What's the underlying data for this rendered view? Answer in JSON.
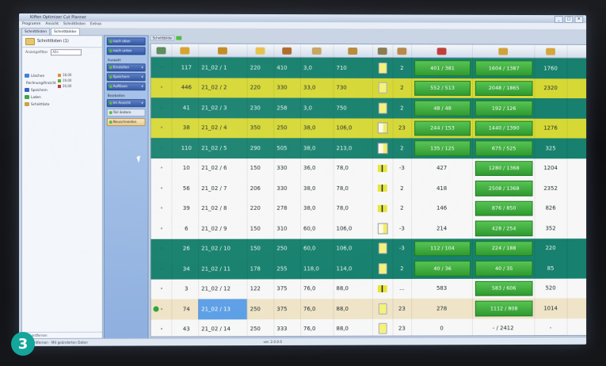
{
  "window": {
    "title": "Kiffen Optimizer Cut Planner",
    "controls": [
      "_",
      "□",
      "✕"
    ]
  },
  "menu": [
    "Programm",
    "Ansicht",
    "Schnittlisten",
    "Extras"
  ],
  "tabs": [
    "Schnittlisten",
    "Schnittbilder"
  ],
  "left_panel": {
    "title": "Schnittlisten (1)",
    "filter_label": "Anzeigefilter",
    "filter_value": "Alle",
    "items": [
      {
        "label": "Löschen",
        "color": "#3b7fd6"
      },
      {
        "label": "Rechnung/Ansicht",
        "color": "#9bb3d6"
      },
      {
        "label": "Speichern",
        "color": "#2a60c0"
      },
      {
        "label": "Laden",
        "color": "#3aa43a"
      },
      {
        "label": "Schnittliste",
        "color": "#c9a23a"
      }
    ],
    "legend": [
      {
        "label": "18,00",
        "color": "#e08a2a"
      },
      {
        "label": "19,00",
        "color": "#55aa33"
      },
      {
        "label": "20,00",
        "color": "#c03030"
      }
    ],
    "status": "Wolf entfernen"
  },
  "actions": {
    "buttons": [
      {
        "label": "nach oben",
        "style": "blue"
      },
      {
        "label": "nach unten",
        "style": "blue"
      },
      {
        "label": "Auswahl",
        "style": "sep"
      },
      {
        "label": "Einstellen",
        "style": "blue",
        "arrow": true
      },
      {
        "label": "Speichern",
        "style": "blue",
        "arrow": true
      },
      {
        "label": "Auflösen",
        "style": "blue",
        "arrow": true
      },
      {
        "label": "Bearbeiten",
        "style": "sep"
      },
      {
        "label": "Im Ansicht",
        "style": "blue",
        "arrow": true
      },
      {
        "label": "Teil ändern",
        "style": "light"
      },
      {
        "label": "Neuschneiden",
        "style": "orange"
      }
    ]
  },
  "toolstrip": {
    "label": "Schnittbilder"
  },
  "grid": {
    "header_icons": [
      {
        "name": "status-icon",
        "color": "#5a8a5a"
      },
      {
        "name": "parts-icon",
        "color": "#d7a22a"
      },
      {
        "name": "board-id-icon",
        "color": "#c28a20"
      },
      {
        "name": "length-icon",
        "color": "#e6c24a"
      },
      {
        "name": "width-icon",
        "color": "#b06a2a"
      },
      {
        "name": "thickness-icon",
        "color": "#c8a560"
      },
      {
        "name": "area-icon",
        "color": "#b88a3a"
      },
      {
        "name": "pattern-icon",
        "color": "#8a7a50"
      },
      {
        "name": "count-icon",
        "color": "#b8884a"
      },
      {
        "name": "sum-parts-icon",
        "color": "#c0403a"
      },
      {
        "name": "sum-area-icon",
        "color": "#d0a23a"
      },
      {
        "name": "stack-icon",
        "color": "#d6a63a"
      }
    ],
    "rows": [
      {
        "color": "teal",
        "n": "117",
        "id": "21_02 / 1",
        "l": "220",
        "w": "410",
        "t": "3,0",
        "a": "710",
        "g": "yellow",
        "c": "2",
        "p": "401 / 381",
        "s": "1604 / 1387",
        "x": "1760",
        "p_box": true,
        "s_box": true
      },
      {
        "color": "yellow",
        "n": "446",
        "id": "21_02 / 2",
        "l": "220",
        "w": "330",
        "t": "33,0",
        "a": "730",
        "g": "yellow",
        "c": "2",
        "p": "552 / 513",
        "s": "2048 / 1865",
        "x": "2320",
        "p_box": true,
        "s_box": true
      },
      {
        "color": "teal",
        "n": "41",
        "id": "21_02 / 3",
        "l": "230",
        "w": "258",
        "t": "3,0",
        "a": "750",
        "g": "yellow",
        "c": "2",
        "p": "48 / 48",
        "s": "192 / 126",
        "x": "",
        "p_box": true,
        "s_box": true
      },
      {
        "color": "yellow",
        "n": "38",
        "id": "21_02 / 4",
        "l": "350",
        "w": "250",
        "t": "38,0",
        "a": "106,0",
        "g": "half",
        "c": "23",
        "p": "244 / 153",
        "s": "1440 / 1390",
        "x": "1276",
        "p_box": true,
        "s_box": true
      },
      {
        "color": "teal",
        "n": "110",
        "id": "21_02 / 5",
        "l": "290",
        "w": "505",
        "t": "38,0",
        "a": "213,0",
        "g": "half",
        "c": "2",
        "p": "135 / 125",
        "s": "675 / 525",
        "x": "325",
        "p_box": true,
        "s_box": true
      },
      {
        "color": "white",
        "n": "10",
        "id": "21_02 / 6",
        "l": "150",
        "w": "330",
        "t": "36,0",
        "a": "78,0",
        "g": "bar",
        "c": "-3",
        "p": "427",
        "s": "1280 / 1368",
        "x": "1204",
        "p_box": false,
        "s_box": true
      },
      {
        "color": "white",
        "n": "56",
        "id": "21_02 / 7",
        "l": "206",
        "w": "330",
        "t": "38,0",
        "a": "78,0",
        "g": "bar",
        "c": "2",
        "p": "418",
        "s": "2508 / 1368",
        "x": "2352",
        "p_box": false,
        "s_box": true
      },
      {
        "color": "white",
        "n": "39",
        "id": "21_02 / 8",
        "l": "220",
        "w": "278",
        "t": "38,0",
        "a": "78,0",
        "g": "bar",
        "c": "2",
        "p": "146",
        "s": "876 / 850",
        "x": "826",
        "p_box": false,
        "s_box": true
      },
      {
        "color": "white",
        "n": "6",
        "id": "21_02 / 9",
        "l": "150",
        "w": "310",
        "t": "60,0",
        "a": "106,0",
        "g": "half",
        "c": "-3",
        "p": "214",
        "s": "428 / 254",
        "x": "352",
        "p_box": false,
        "s_box": true
      },
      {
        "color": "teal",
        "n": "26",
        "id": "21_02 / 10",
        "l": "150",
        "w": "250",
        "t": "60,0",
        "a": "106,0",
        "g": "yellow",
        "c": "-3",
        "p": "112 / 104",
        "s": "224 / 188",
        "x": "220",
        "p_box": true,
        "s_box": true
      },
      {
        "color": "teal",
        "n": "34",
        "id": "21_02 / 11",
        "l": "178",
        "w": "255",
        "t": "118,0",
        "a": "114,0",
        "g": "yellow",
        "c": "2",
        "p": "40 / 36",
        "s": "40 / 35",
        "x": "85",
        "p_box": true,
        "s_box": true
      },
      {
        "color": "white",
        "n": "3",
        "id": "21_02 / 12",
        "l": "122",
        "w": "375",
        "t": "76,0",
        "a": "88,0",
        "g": "bar",
        "c": "...",
        "p": "583",
        "s": "583 / 606",
        "x": "520",
        "p_box": false,
        "s_box": true
      },
      {
        "color": "beige",
        "n": "74",
        "id": "21_02 / 13",
        "l": "250",
        "w": "375",
        "t": "76,0",
        "a": "88,0",
        "g": "yellow",
        "c": "23",
        "p": "278",
        "s": "1112 / 808",
        "x": "1014",
        "p_box": false,
        "s_box": true,
        "ok": true,
        "selected": true
      },
      {
        "color": "white",
        "n": "43",
        "id": "21_02 / 14",
        "l": "250",
        "w": "333",
        "t": "76,0",
        "a": "88,0",
        "g": "yellow",
        "c": "23",
        "p": "0",
        "s": "- / 2412",
        "x": "-",
        "p_box": false,
        "s_box": false
      }
    ]
  },
  "statusbar": {
    "left": "Wolf entfernen · Mit geänderten Daten",
    "middle": "ver. 2.0.0.0"
  },
  "badge": "3",
  "colors": {
    "teal": "#17806e",
    "yellow": "#d6d836",
    "white": "#f7f7f7",
    "beige": "#efe4c8",
    "green": "#3fae3c"
  }
}
